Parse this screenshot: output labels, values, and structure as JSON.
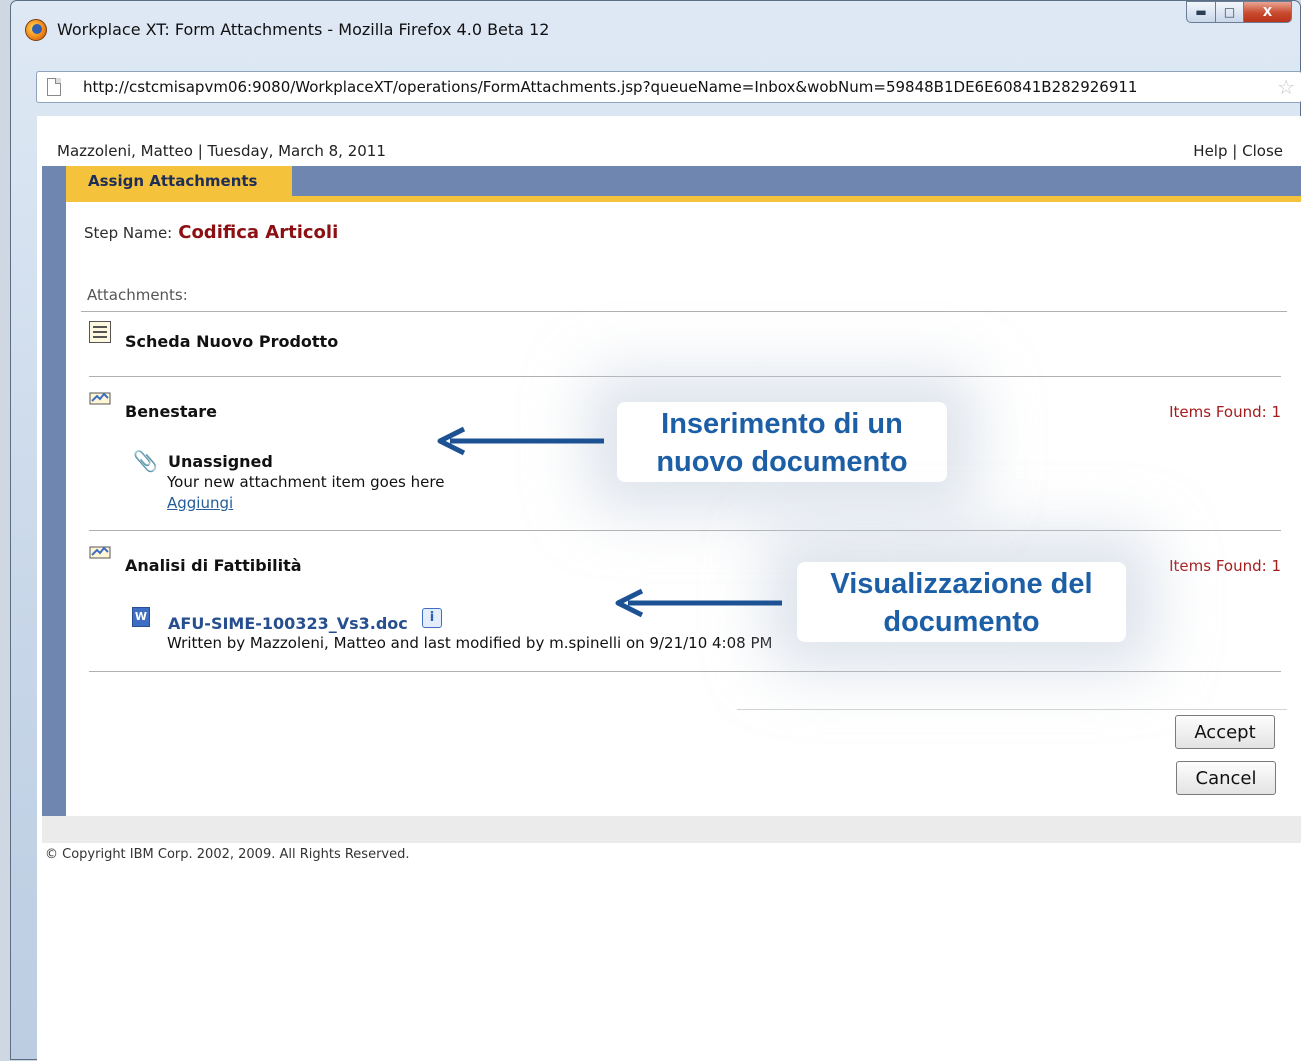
{
  "window": {
    "title": "Workplace XT: Form Attachments - Mozilla Firefox 4.0 Beta 12",
    "url": "http://cstcmisapvm06:9080/WorkplaceXT/operations/FormAttachments.jsp?queueName=Inbox&wobNum=59848B1DE6E60841B282926911"
  },
  "header": {
    "user_date": "Mazzoleni, Matteo | Tuesday, March 8, 2011",
    "help": "Help",
    "separator": "|",
    "close": "Close",
    "tab": "Assign Attachments"
  },
  "step": {
    "label": "Step Name:",
    "value": "Codifica Articoli"
  },
  "attachments": {
    "label": "Attachments:",
    "scheda": {
      "title": "Scheda Nuovo Prodotto"
    },
    "benestare": {
      "title": "Benestare",
      "items_found": "Items Found: 1",
      "unassigned": "Unassigned",
      "description": "Your new attachment item goes here",
      "add_link": "Aggiungi"
    },
    "analisi": {
      "title": "Analisi di Fattibilità",
      "items_found": "Items Found: 1",
      "doc_name": "AFU-SIME-100323_Vs3.doc",
      "doc_info": "Written by Mazzoleni, Matteo and last modified by m.spinelli on 9/21/10 4:08 PM"
    }
  },
  "buttons": {
    "accept": "Accept",
    "cancel": "Cancel"
  },
  "footer": {
    "copyright": "© Copyright IBM Corp. 2002, 2009. All Rights Reserved."
  },
  "callouts": {
    "insert_line1": "Inserimento di un",
    "insert_line2": "nuovo documento",
    "view_line1": "Visualizzazione del",
    "view_line2": "documento"
  },
  "colors": {
    "header_blue": "#6e86b0",
    "tab_yellow": "#f4c23b",
    "step_value_red": "#8d0f13",
    "items_found_red": "#a61b1b",
    "callout_blue": "#1c5fa6"
  }
}
